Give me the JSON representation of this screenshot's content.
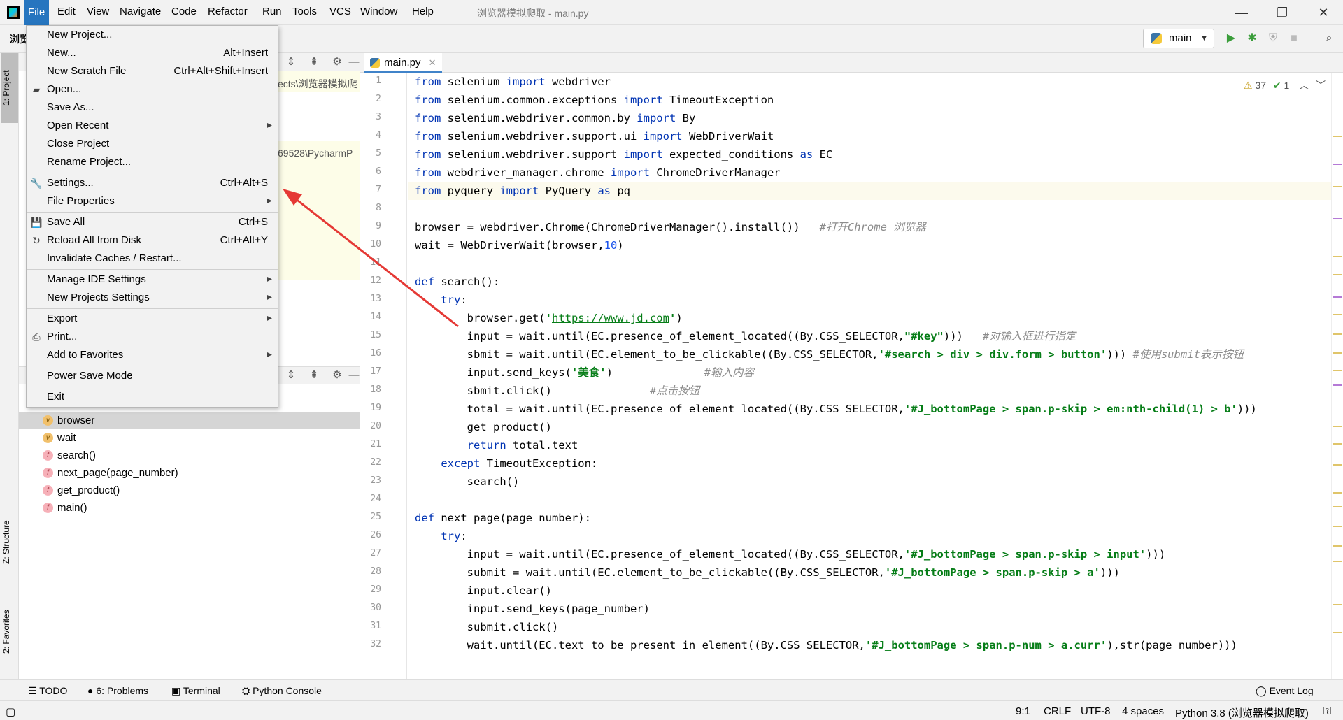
{
  "menubar": {
    "items": [
      "File",
      "Edit",
      "View",
      "Navigate",
      "Code",
      "Refactor",
      "Run",
      "Tools",
      "VCS",
      "Window",
      "Help"
    ],
    "window_title": "浏览器模拟爬取 - main.py"
  },
  "toolbar": {
    "project_crumb": "浏览",
    "run_config": "main"
  },
  "file_menu": {
    "items": [
      {
        "label": "New Project...",
        "shortcut": ""
      },
      {
        "label": "New...",
        "shortcut": "Alt+Insert"
      },
      {
        "label": "New Scratch File",
        "shortcut": "Ctrl+Alt+Shift+Insert"
      },
      {
        "label": "Open...",
        "shortcut": ""
      },
      {
        "label": "Save As...",
        "shortcut": ""
      },
      {
        "label": "Open Recent",
        "shortcut": ""
      },
      {
        "label": "Close Project",
        "shortcut": ""
      },
      {
        "label": "Rename Project...",
        "shortcut": ""
      },
      {
        "label": "Settings...",
        "shortcut": "Ctrl+Alt+S"
      },
      {
        "label": "File Properties",
        "shortcut": ""
      },
      {
        "label": "Save All",
        "shortcut": "Ctrl+S"
      },
      {
        "label": "Reload All from Disk",
        "shortcut": "Ctrl+Alt+Y"
      },
      {
        "label": "Invalidate Caches / Restart...",
        "shortcut": ""
      },
      {
        "label": "Manage IDE Settings",
        "shortcut": ""
      },
      {
        "label": "New Projects Settings",
        "shortcut": ""
      },
      {
        "label": "Export",
        "shortcut": ""
      },
      {
        "label": "Print...",
        "shortcut": ""
      },
      {
        "label": "Add to Favorites",
        "shortcut": ""
      },
      {
        "label": "Power Save Mode",
        "shortcut": ""
      },
      {
        "label": "Exit",
        "shortcut": ""
      }
    ]
  },
  "left_stripe": {
    "project": "1: Project",
    "structure": "Z: Structure",
    "favorites": "2: Favorites"
  },
  "project_panel": {
    "path1": "ects\\浏览器模拟爬",
    "path2": "69528\\PycharmP"
  },
  "structure": {
    "items": [
      {
        "badge": "v",
        "label": "browser"
      },
      {
        "badge": "v",
        "label": "wait"
      },
      {
        "badge": "f",
        "label": "search()"
      },
      {
        "badge": "f",
        "label": "next_page(page_number)"
      },
      {
        "badge": "f",
        "label": "get_product()"
      },
      {
        "badge": "f",
        "label": "main()"
      }
    ]
  },
  "editor": {
    "tab": "main.py",
    "inspections": {
      "warnings": "37",
      "ok": "1"
    },
    "line_numbers": [
      "1",
      "2",
      "3",
      "4",
      "5",
      "6",
      "7",
      "8",
      "9",
      "10",
      "11",
      "12",
      "13",
      "14",
      "15",
      "16",
      "17",
      "18",
      "19",
      "20",
      "21",
      "22",
      "23",
      "24",
      "25",
      "26",
      "27",
      "28",
      "29",
      "30",
      "31",
      "32"
    ]
  },
  "bottom_tools": {
    "todo": "TODO",
    "problems": "6: Problems",
    "terminal": "Terminal",
    "python_console": "Python Console",
    "event_log": "Event Log"
  },
  "statusbar": {
    "position": "9:1",
    "line_sep": "CRLF",
    "encoding": "UTF-8",
    "indent": "4 spaces",
    "interpreter": "Python 3.8 (浏览器模拟爬取)"
  },
  "colors": {
    "keyword": "#0033b3",
    "string": "#067d17",
    "number": "#1750eb",
    "comment": "#8c8c8c",
    "menu_active": "#2675bf",
    "annotation_arrow": "#e53935"
  }
}
